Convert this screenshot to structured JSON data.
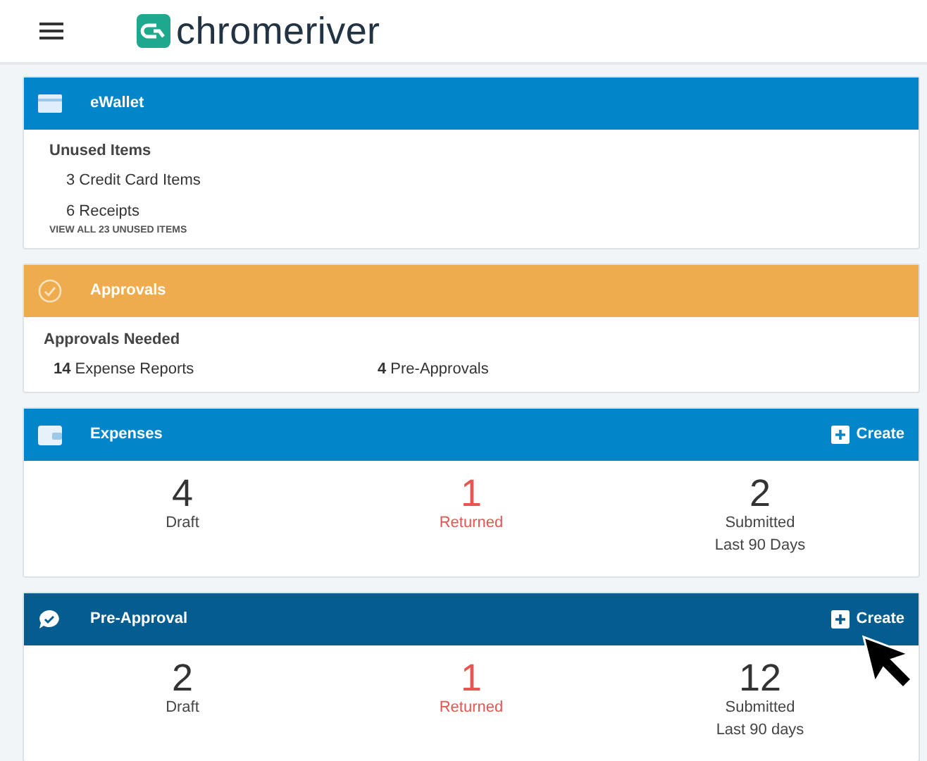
{
  "header": {
    "logo_text": "chromeriver"
  },
  "cards": [
    {
      "kind": "list",
      "title": "eWallet",
      "color": "#0286c9",
      "heading": "Unused Items",
      "items": [
        "3 Credit Card Items",
        "6 Receipts"
      ],
      "link": "VIEW ALL 23 UNUSED ITEMS"
    },
    {
      "kind": "approvals",
      "title": "Approvals",
      "color": "#efac4f",
      "heading": "Approvals Needed",
      "items": [
        "**14** Expense Reports",
        "**4** Pre-Approvals"
      ]
    },
    {
      "kind": "stats",
      "title": "Expenses",
      "color": "#0286c9",
      "action": "Create",
      "stats": [
        {
          "value": "4",
          "label": "Draft",
          "alert": false
        },
        {
          "value": "1",
          "label": "Returned",
          "alert": true
        },
        {
          "value": "2",
          "label": "Submitted",
          "note": "Last 90 Days",
          "alert": false
        }
      ]
    },
    {
      "kind": "stats",
      "title": "Pre-Approval",
      "color": "#045c8f",
      "action": "Create",
      "stats": [
        {
          "value": "2",
          "label": "Draft",
          "alert": false
        },
        {
          "value": "1",
          "label": "Returned",
          "alert": true
        },
        {
          "value": "12",
          "label": "Submitted",
          "note": "Last 90 days",
          "alert": false
        }
      ]
    }
  ]
}
